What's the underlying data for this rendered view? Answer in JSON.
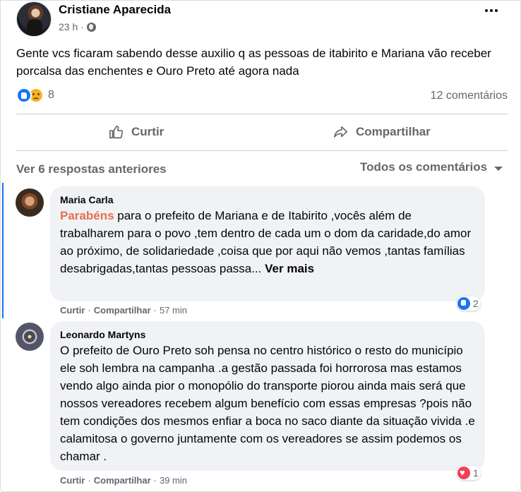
{
  "post": {
    "author": "Cristiane Aparecida",
    "time": "23 h",
    "separator": "·",
    "privacy_icon": "globe-icon",
    "text": "Gente vcs ficaram sabendo desse auxilio q as pessoas de itabirito e Mariana vão receber porcalsa das enchentes e Ouro Preto até agora nada",
    "reactions": {
      "icons": [
        "like-icon",
        "sad-icon"
      ],
      "count": "8"
    },
    "comments_count": "12 comentários"
  },
  "actions": {
    "like_label": "Curtir",
    "share_label": "Compartilhar"
  },
  "comments_header": {
    "previous": "Ver 6 respostas anteriores",
    "sort": "Todos os comentários"
  },
  "comments": [
    {
      "author": "Maria Carla",
      "link_word": "Parabéns",
      "text": " para o prefeito de Mariana e de Itabirito ,vocês além de trabalharem para o povo ,tem dentro de cada um o dom da caridade,do amor ao próximo, de solidariedade ,coisa que por aqui não vemos ,tantas famílias desabrigadas,tantas pessoas passa... ",
      "see_more": "Ver mais",
      "like": "Curtir",
      "share": "Compartilhar",
      "dot": "·",
      "time": "57 min",
      "reaction_icon": "like-icon",
      "reaction_count": "2"
    },
    {
      "author": "Leonardo Martyns",
      "text": "O prefeito de Ouro Preto soh pensa no centro histórico o resto do município ele soh lembra na campanha .a gestão passada foi horrorosa mas estamos vendo algo ainda pior o monopólio do transporte piorou ainda mais será que nossos vereadores recebem algum benefício com essas empresas ?pois não tem condições dos mesmos enfiar a boca no saco diante da situação vivida .e calamitosa o governo juntamente com os vereadores se assim podemos os chamar .",
      "like": "Curtir",
      "share": "Compartilhar",
      "dot": "·",
      "time": "39 min",
      "reaction_icon": "love-icon",
      "reaction_count": "1"
    }
  ],
  "colors": {
    "primary_text": "#050505",
    "secondary_text": "#65676b",
    "bubble": "#f0f2f5",
    "like_blue": "#1877f2",
    "love_red": "#f33e58",
    "link_orange": "#e4704a"
  }
}
